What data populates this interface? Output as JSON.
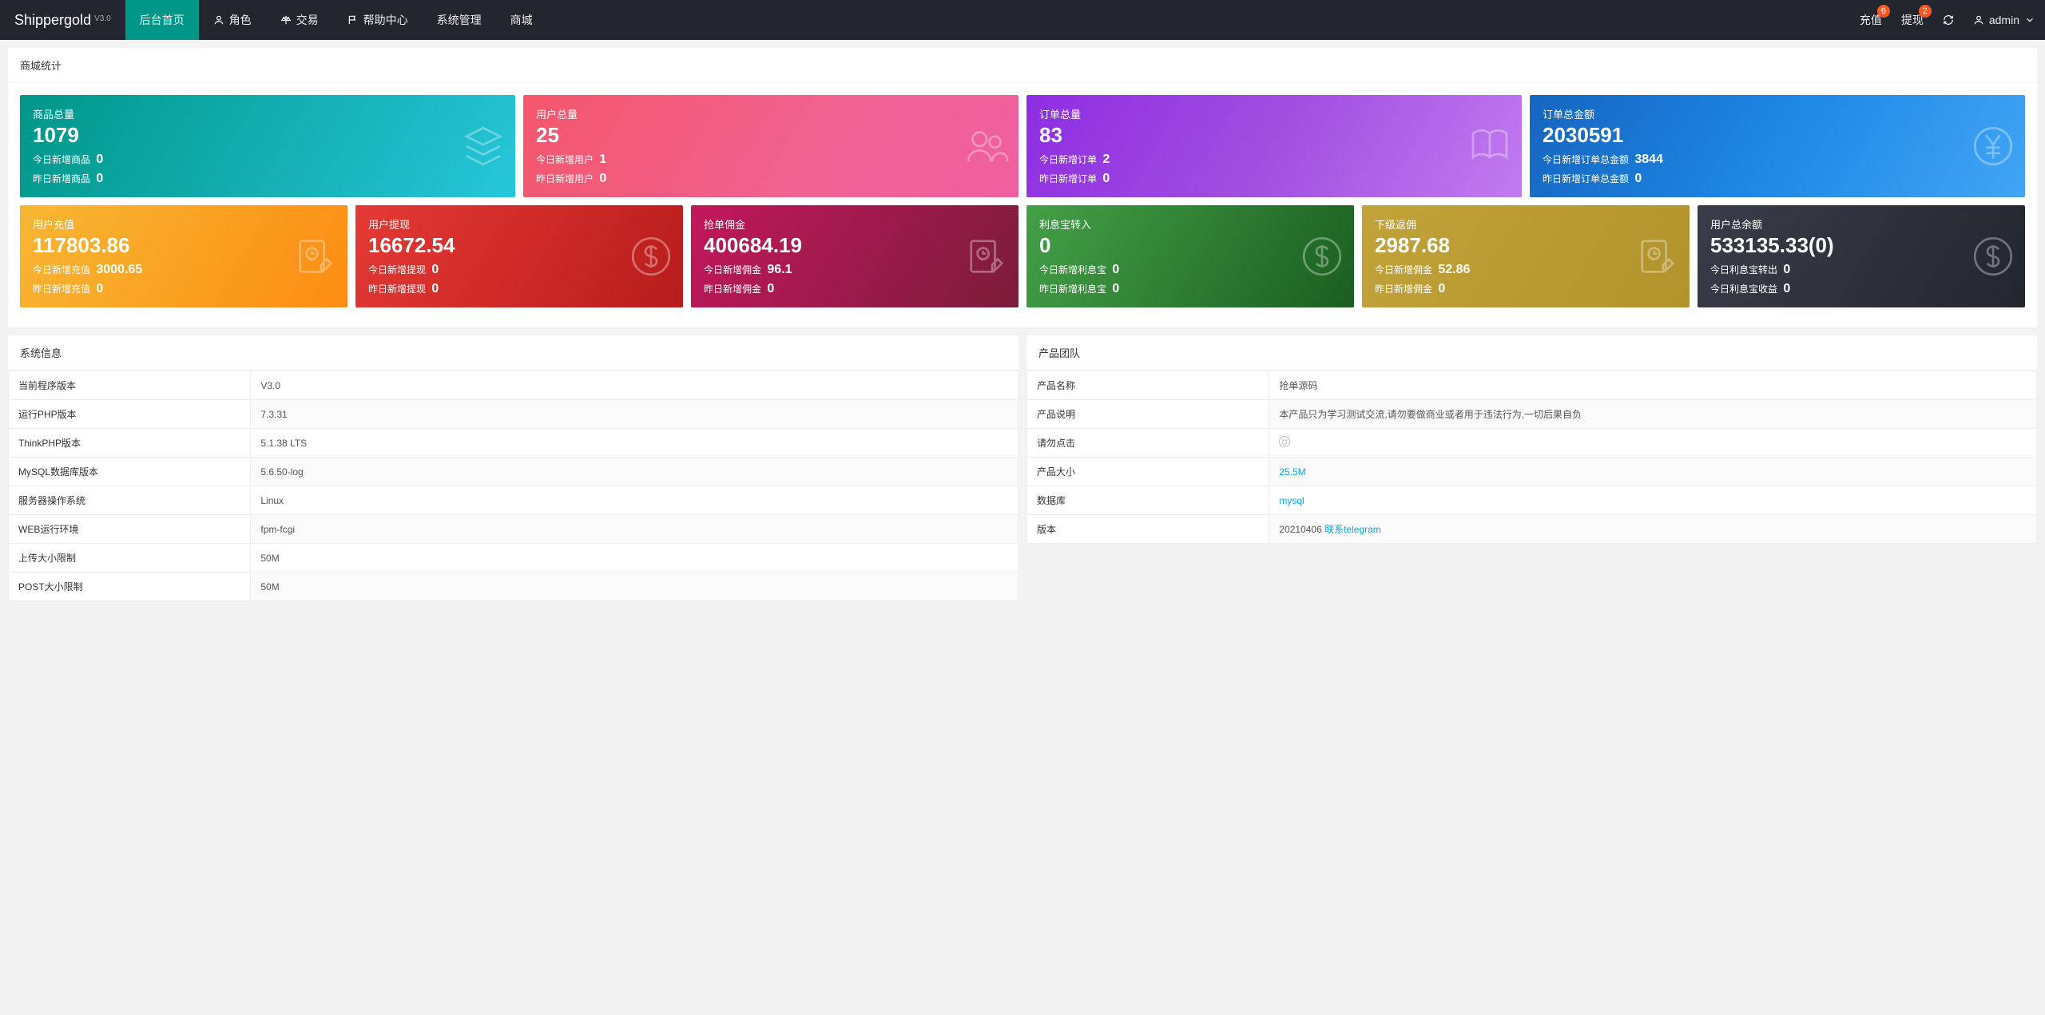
{
  "brand": {
    "name": "Shippergold",
    "version": "V3.0"
  },
  "nav": {
    "items": [
      {
        "label": "后台首页",
        "icon": null,
        "active": true
      },
      {
        "label": "角色",
        "icon": "user"
      },
      {
        "label": "交易",
        "icon": "scale"
      },
      {
        "label": "帮助中心",
        "icon": "flag"
      },
      {
        "label": "系统管理",
        "icon": null
      },
      {
        "label": "商城",
        "icon": null
      }
    ],
    "right": {
      "recharge": {
        "label": "充值",
        "badge": "6"
      },
      "withdraw": {
        "label": "提现",
        "badge": "2"
      },
      "user": "admin"
    }
  },
  "stats_title": "商城统计",
  "row1": [
    {
      "title": "商品总量",
      "value": "1079",
      "today_label": "今日新增商品",
      "today_value": "0",
      "yesterday_label": "昨日新增商品",
      "yesterday_value": "0",
      "gradient": "g-teal",
      "icon": "stack"
    },
    {
      "title": "用户总量",
      "value": "25",
      "today_label": "今日新增用户",
      "today_value": "1",
      "yesterday_label": "昨日新增用户",
      "yesterday_value": "0",
      "gradient": "g-pink",
      "icon": "users"
    },
    {
      "title": "订单总量",
      "value": "83",
      "today_label": "今日新增订单",
      "today_value": "2",
      "yesterday_label": "昨日新增订单",
      "yesterday_value": "0",
      "gradient": "g-purple",
      "icon": "book"
    },
    {
      "title": "订单总金额",
      "value": "2030591",
      "today_label": "今日新增订单总金额",
      "today_value": "3844",
      "yesterday_label": "昨日新增订单总金额",
      "yesterday_value": "0",
      "gradient": "g-blue",
      "icon": "yen"
    }
  ],
  "row2": [
    {
      "title": "用户充值",
      "value": "117803.86",
      "today_label": "今日新增充值",
      "today_value": "3000.65",
      "yesterday_label": "昨日新增充值",
      "yesterday_value": "0",
      "gradient": "g-orange",
      "icon": "edit"
    },
    {
      "title": "用户提现",
      "value": "16672.54",
      "today_label": "今日新增提现",
      "today_value": "0",
      "yesterday_label": "昨日新增提现",
      "yesterday_value": "0",
      "gradient": "g-red",
      "icon": "dollar"
    },
    {
      "title": "抢单佣金",
      "value": "400684.19",
      "today_label": "今日新增佣金",
      "today_value": "96.1",
      "yesterday_label": "昨日新增佣金",
      "yesterday_value": "0",
      "gradient": "g-crimson",
      "icon": "edit"
    },
    {
      "title": "利息宝转入",
      "value": "0",
      "today_label": "今日新增利息宝",
      "today_value": "0",
      "yesterday_label": "昨日新增利息宝",
      "yesterday_value": "0",
      "gradient": "g-green",
      "icon": "dollar"
    },
    {
      "title": "下级返佣",
      "value": "2987.68",
      "today_label": "今日新增佣金",
      "today_value": "52.86",
      "yesterday_label": "昨日新增佣金",
      "yesterday_value": "0",
      "gradient": "g-olive",
      "icon": "edit"
    },
    {
      "title": "用户总余额",
      "value": "533135.33(0)",
      "today_label": "今日利息宝转出",
      "today_value": "0",
      "yesterday_label": "今日利息宝收益",
      "yesterday_value": "0",
      "gradient": "g-dark",
      "icon": "dollar"
    }
  ],
  "sysinfo": {
    "title": "系统信息",
    "rows": [
      {
        "k": "当前程序版本",
        "v": "V3.0"
      },
      {
        "k": "运行PHP版本",
        "v": "7.3.31"
      },
      {
        "k": "ThinkPHP版本",
        "v": "5.1.38 LTS"
      },
      {
        "k": "MySQL数据库版本",
        "v": "5.6.50-log"
      },
      {
        "k": "服务器操作系统",
        "v": "Linux"
      },
      {
        "k": "WEB运行环境",
        "v": "fpm-fcgi"
      },
      {
        "k": "上传大小限制",
        "v": "50M"
      },
      {
        "k": "POST大小限制",
        "v": "50M"
      }
    ]
  },
  "team": {
    "title": "产品团队",
    "rows": [
      {
        "k": "产品名称",
        "v": "抢单源码",
        "link": false
      },
      {
        "k": "产品说明",
        "v": "本产品只为学习测试交流,请勿要做商业或者用于违法行为,一切后果自负",
        "link": false
      },
      {
        "k": "请勿点击",
        "v": "",
        "icon": true
      },
      {
        "k": "产品大小",
        "v": "25.5M",
        "link": true
      },
      {
        "k": "数据库",
        "v": "mysql",
        "link": true
      },
      {
        "k": "版本",
        "v": "20210406",
        "extra_link": "联系telegram"
      }
    ]
  }
}
